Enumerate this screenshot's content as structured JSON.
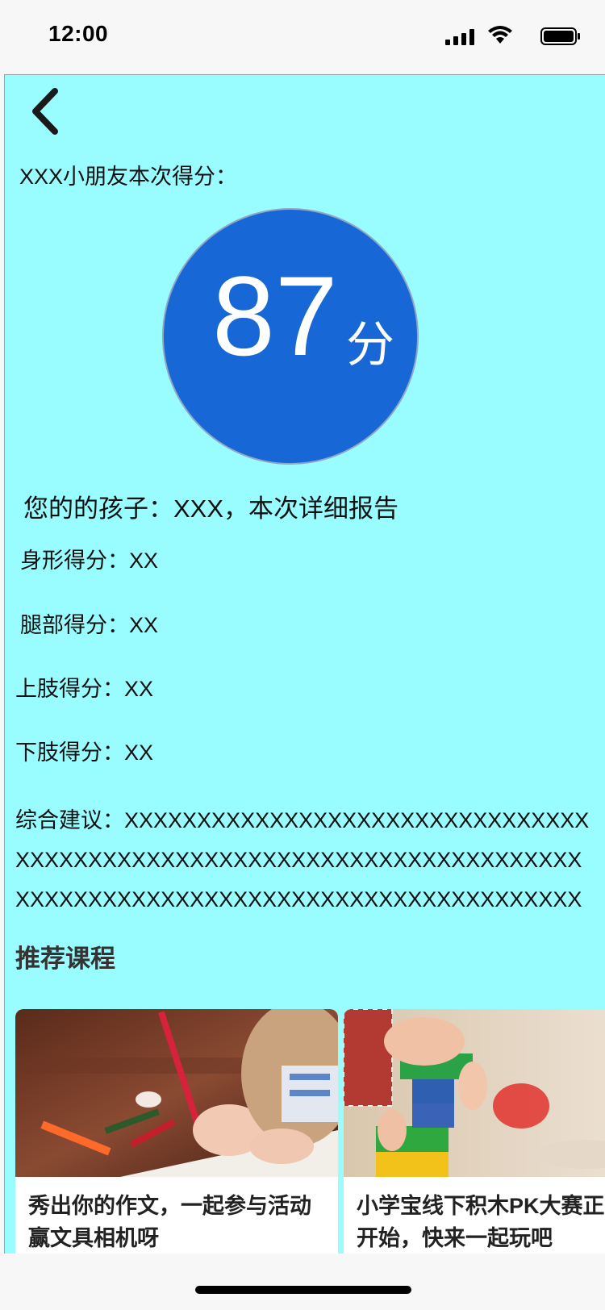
{
  "status_bar": {
    "time": "12:00"
  },
  "report": {
    "intro": "XXX小朋友本次得分：",
    "score_value": "87",
    "score_unit": "分",
    "title": "您的的孩子：XXX，本次详细报告",
    "lines": [
      "身形得分：XX",
      "腿部得分：XX",
      "上肢得分：XX",
      "下肢得分：XX"
    ],
    "advice": "综合建议：XXXXXXXXXXXXXXXXXXXXXXXXXXXXXXXXXXXXXXXXXXXXXXXXXXXXXXXXXXXXXXXXXXXXXXXXXXXXXXXXXXXXXXXXXXXXXXXXXXXXXXXXXXXXXX"
  },
  "recommend": {
    "heading": "推荐课程",
    "courses": [
      {
        "title": "秀出你的作文，一起参与活动\n赢文具相机呀"
      },
      {
        "title": "小学宝线下积木PK大赛正式\n开始，快来一起玩吧"
      }
    ]
  },
  "icons": {
    "back": "chevron-left-icon",
    "signal": "cellular-signal-icon",
    "wifi": "wifi-icon",
    "battery": "battery-icon"
  },
  "colors": {
    "background": "#99fcfe",
    "score_circle": "#1768d6"
  }
}
